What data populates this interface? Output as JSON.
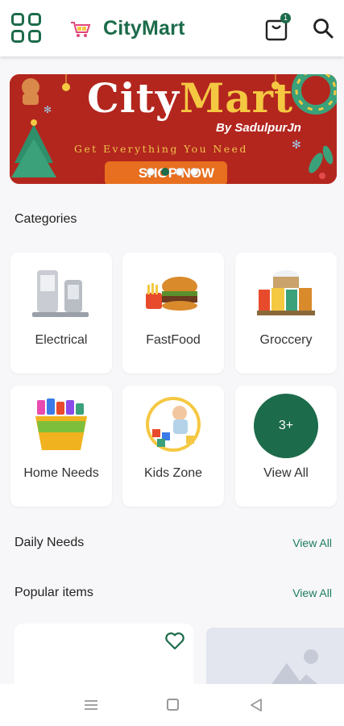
{
  "header": {
    "brand": "CityMart",
    "cart_badge": "1",
    "icons": [
      "grid-menu-icon",
      "cart-logo-icon",
      "shopping-bag-icon",
      "search-icon"
    ]
  },
  "banner": {
    "title_city": "City",
    "title_mart": "Mart",
    "by": "By SadulpurJn",
    "tagline": "Get Everything You Need",
    "cta": "SHOP NOW",
    "slide_count": 4,
    "active_slide": 1
  },
  "categories": {
    "title": "Categories",
    "items": [
      {
        "label": "Electrical",
        "icon": "appliances-image"
      },
      {
        "label": "FastFood",
        "icon": "burger-image"
      },
      {
        "label": "Groccery",
        "icon": "grocery-image"
      },
      {
        "label": "Home Needs",
        "icon": "cleaning-bucket-image"
      },
      {
        "label": "Kids Zone",
        "icon": "kids-toys-image"
      },
      {
        "label": "View All",
        "badge": "3+"
      }
    ]
  },
  "daily_needs": {
    "title": "Daily Needs",
    "view_all": "View All"
  },
  "popular": {
    "title": "Popular items",
    "view_all": "View All"
  },
  "colors": {
    "brand_green": "#1c6b4a",
    "banner_red": "#b3261e",
    "accent_yellow": "#f5c842"
  }
}
